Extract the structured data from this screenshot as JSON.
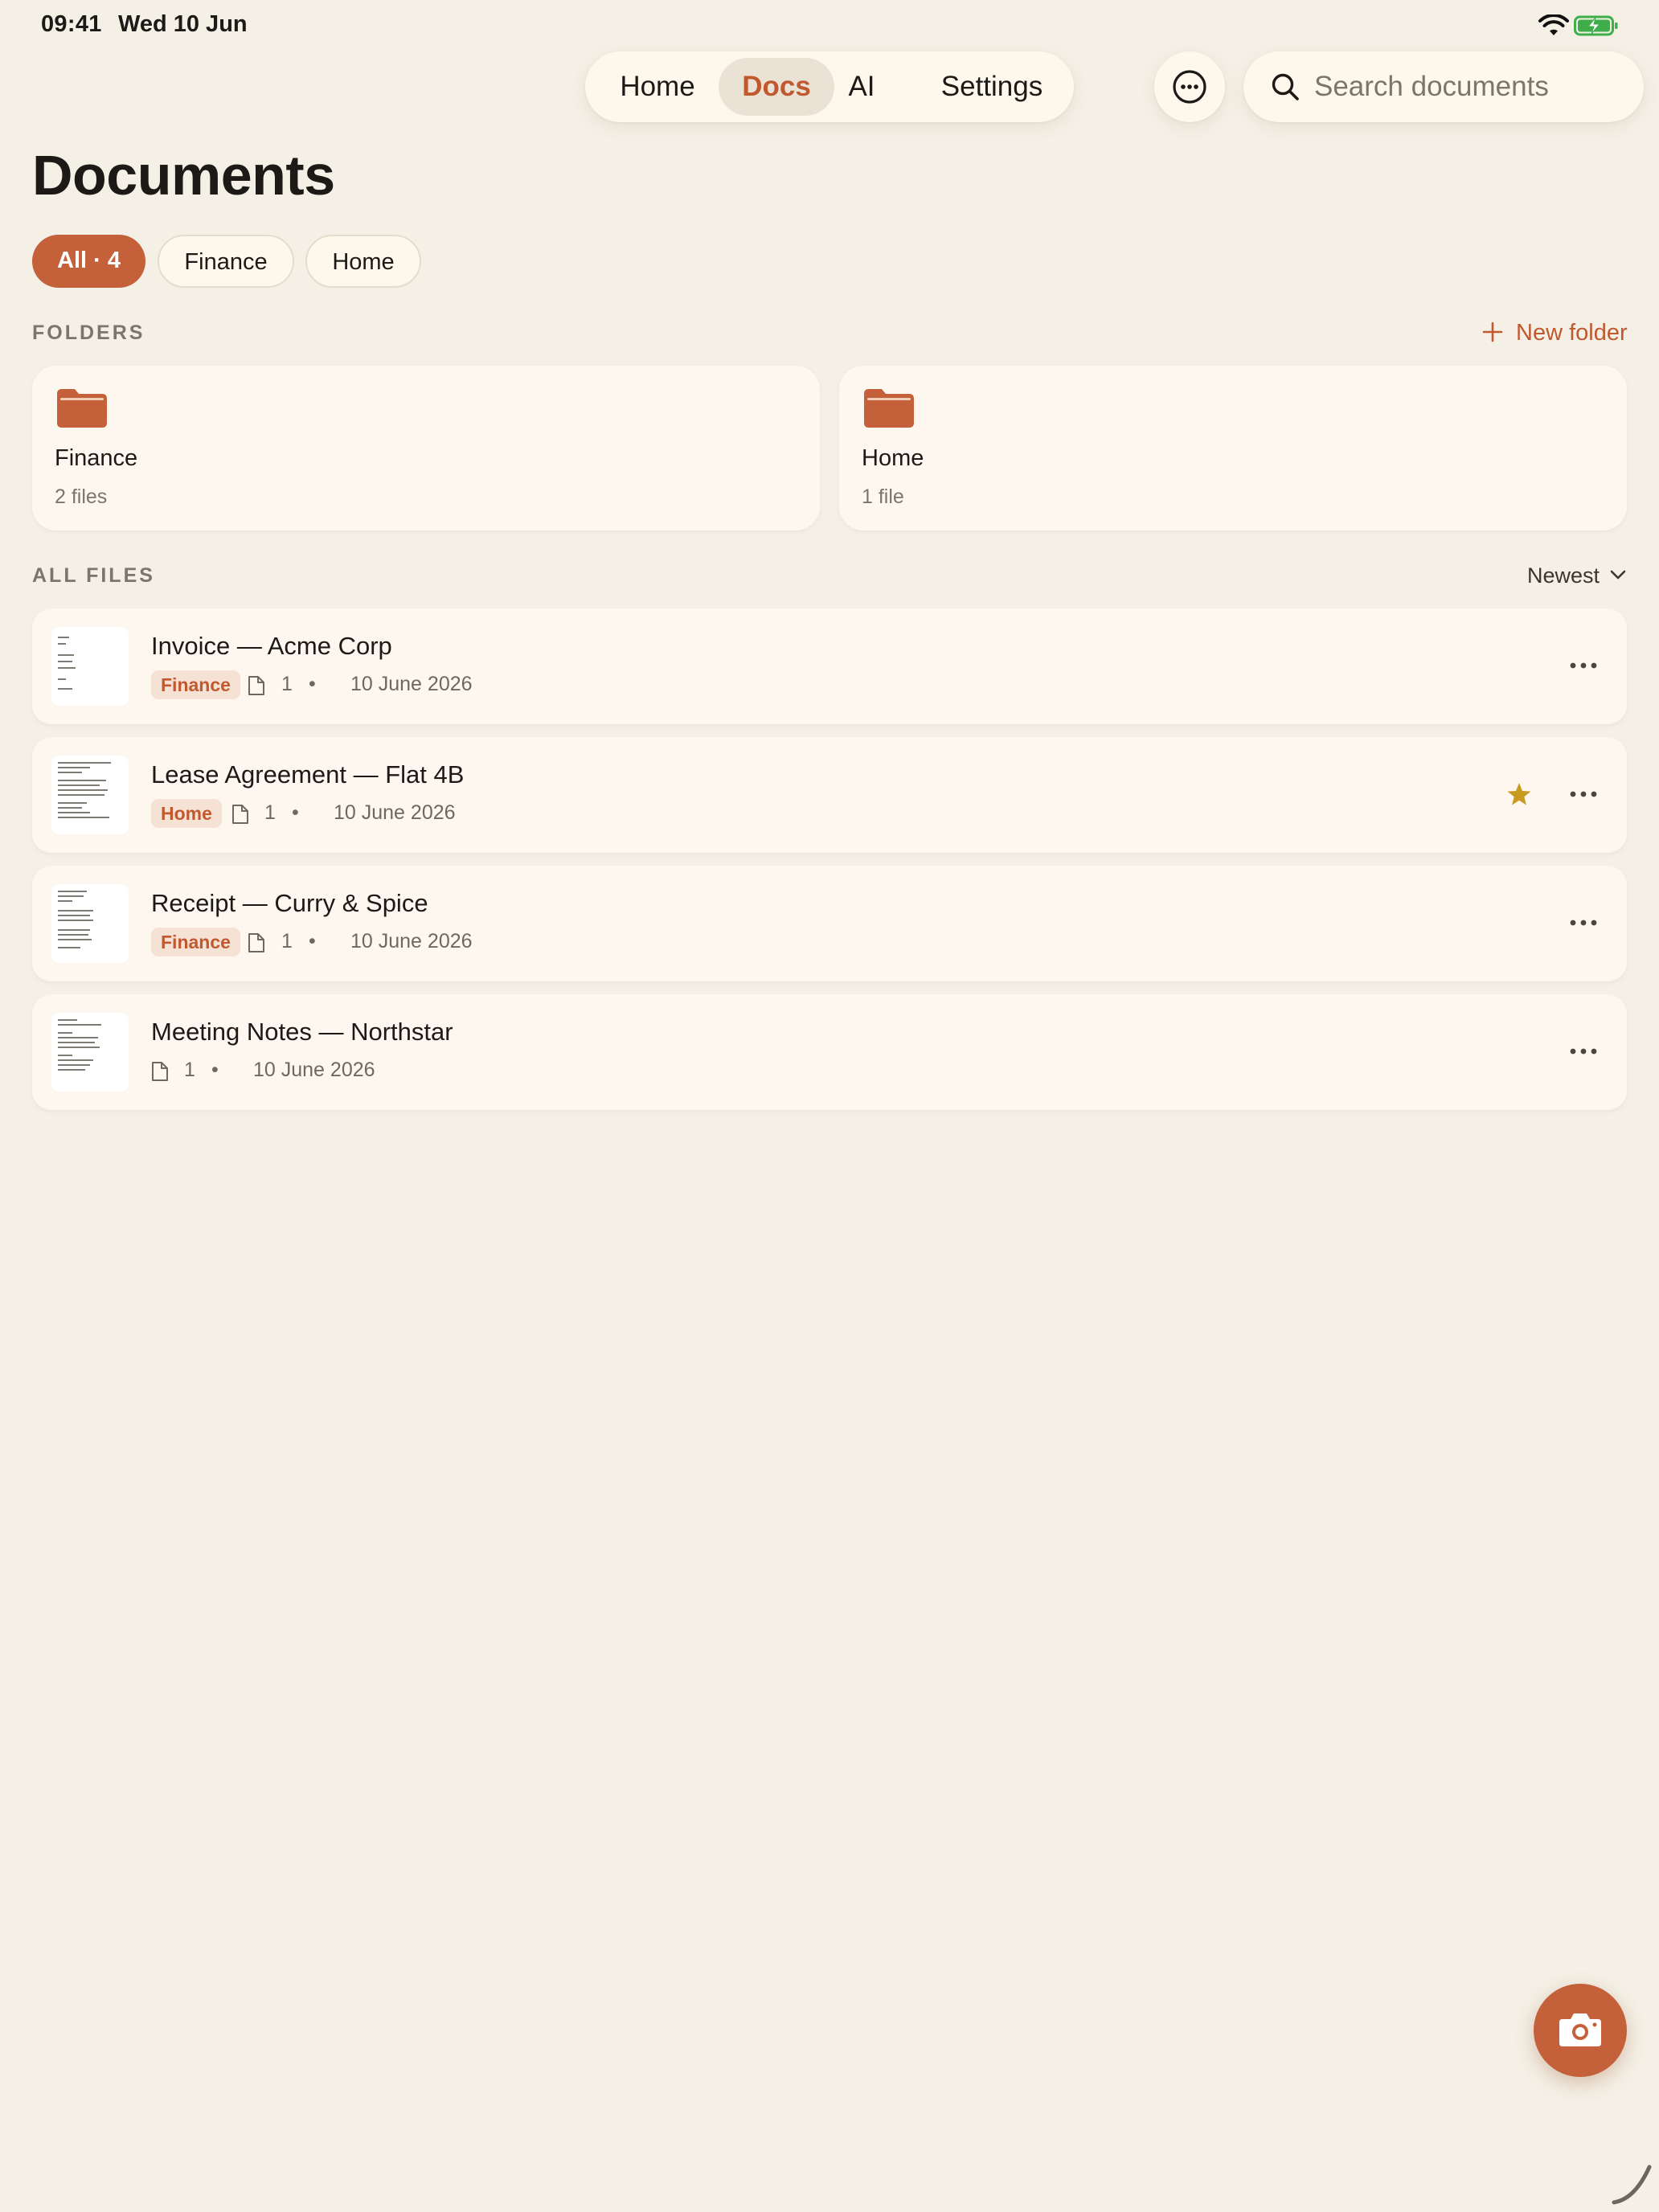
{
  "status_bar": {
    "time": "09:41",
    "date": "Wed 10 Jun"
  },
  "nav": {
    "tabs": [
      {
        "label": "Home",
        "active": false
      },
      {
        "label": "Docs",
        "active": true
      },
      {
        "label": "AI",
        "active": false
      },
      {
        "label": "Settings",
        "active": false
      }
    ],
    "more_icon": "ellipsis-circle-icon"
  },
  "search": {
    "placeholder": "Search documents",
    "value": "",
    "icon": "search-icon"
  },
  "page": {
    "title": "Documents"
  },
  "filters": [
    {
      "label": "All · 4",
      "selected": true
    },
    {
      "label": "Finance",
      "selected": false
    },
    {
      "label": "Home",
      "selected": false
    }
  ],
  "folders_section": {
    "label": "FOLDERS",
    "new_folder_label": "New folder",
    "folders": [
      {
        "name": "Finance",
        "count": "2 files",
        "icon": "folder-icon"
      },
      {
        "name": "Home",
        "count": "1 file",
        "icon": "folder-icon"
      }
    ]
  },
  "files_section": {
    "label": "ALL FILES",
    "sort_label": "Newest",
    "files": [
      {
        "title": "Invoice — Acme Corp",
        "tag": "Finance",
        "pages": "1",
        "date": "10 June 2026",
        "starred": false
      },
      {
        "title": "Lease Agreement — Flat 4B",
        "tag": "Home",
        "pages": "1",
        "date": "10 June 2026",
        "starred": true
      },
      {
        "title": "Receipt — Curry & Spice",
        "tag": "Finance",
        "pages": "1",
        "date": "10 June 2026",
        "starred": false
      },
      {
        "title": "Meeting Notes — Northstar",
        "tag": "",
        "pages": "1",
        "date": "10 June 2026",
        "starred": false
      }
    ]
  },
  "colors": {
    "accent": "#C4613A",
    "background": "#F4F0E6",
    "card": "#FEF7EF",
    "tag_background": "#F6E1D5",
    "star": "#C99A22"
  },
  "camera_button": {
    "icon": "camera-icon"
  }
}
